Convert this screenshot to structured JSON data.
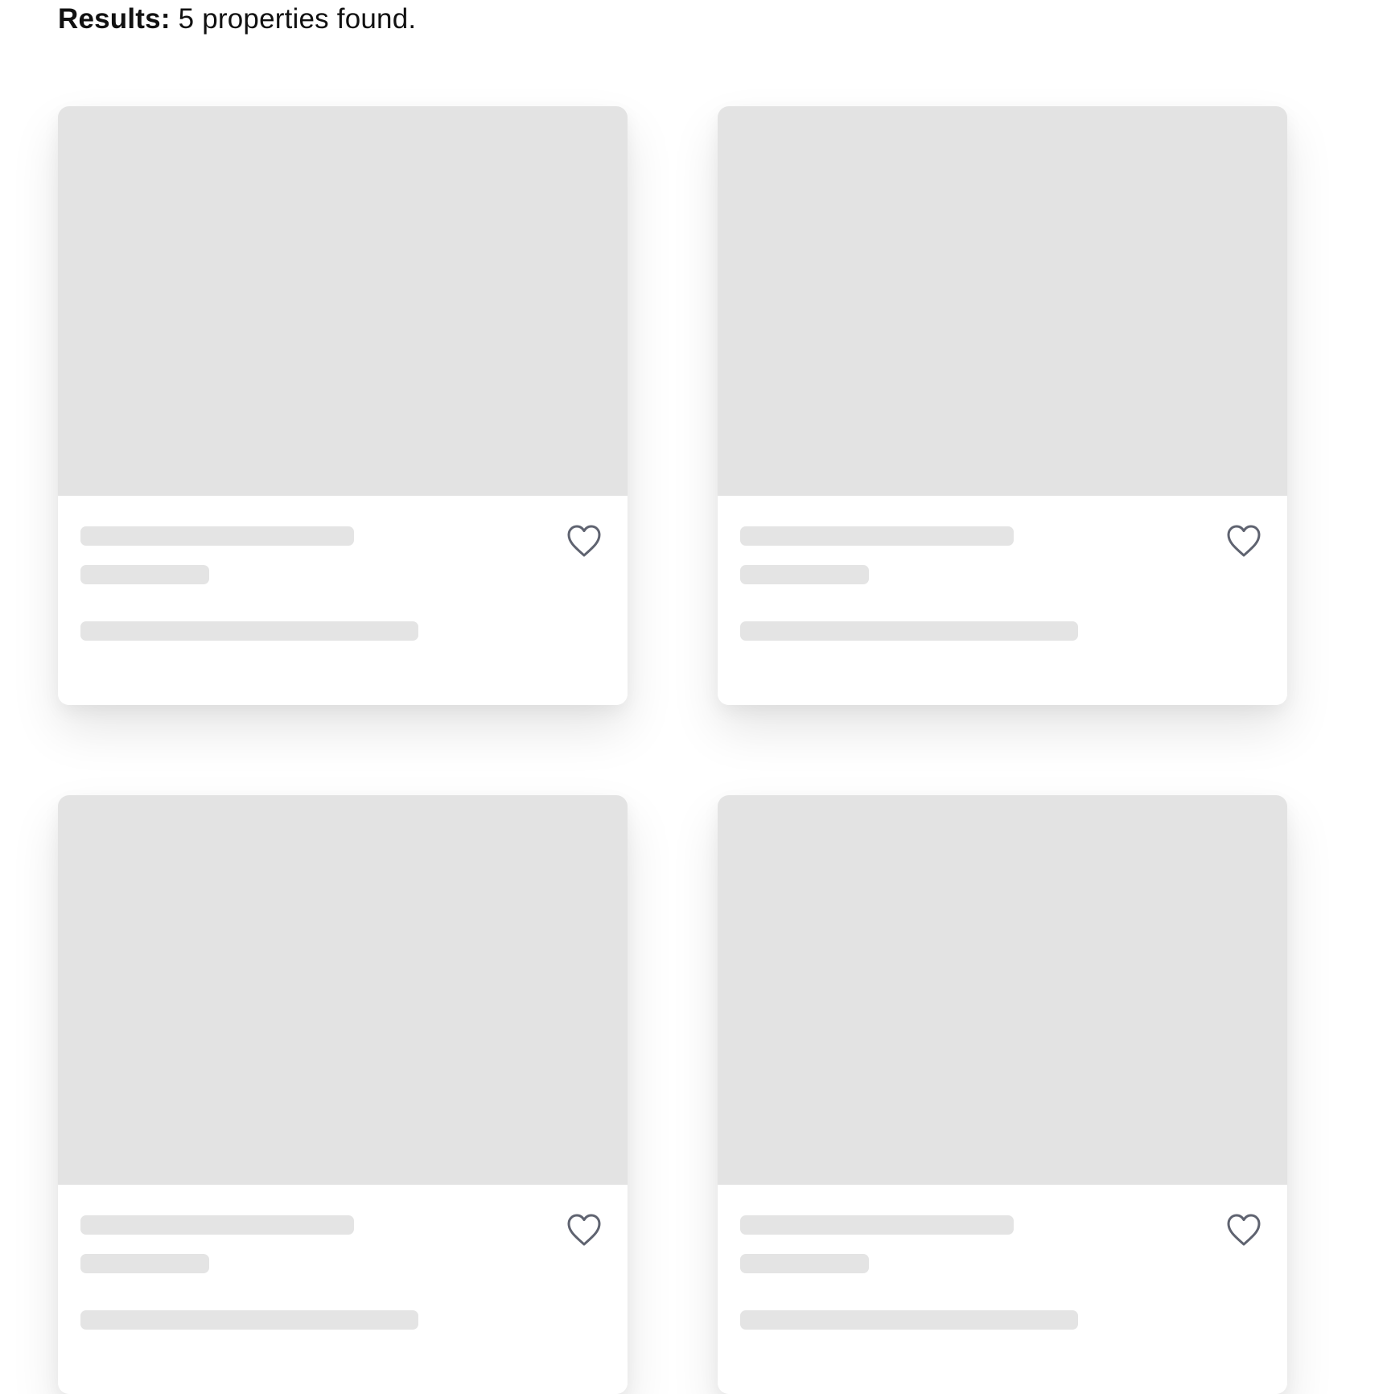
{
  "results": {
    "label": "Results:",
    "text": "5 properties found."
  },
  "cards": [
    {
      "state": "loading",
      "favorite_icon": "heart-outline-icon"
    },
    {
      "state": "loading",
      "favorite_icon": "heart-outline-icon"
    },
    {
      "state": "loading",
      "favorite_icon": "heart-outline-icon"
    },
    {
      "state": "loading",
      "favorite_icon": "heart-outline-icon"
    }
  ],
  "colors": {
    "skeleton": "#e3e3e3",
    "icon": "#5f6370",
    "text": "#111111"
  }
}
